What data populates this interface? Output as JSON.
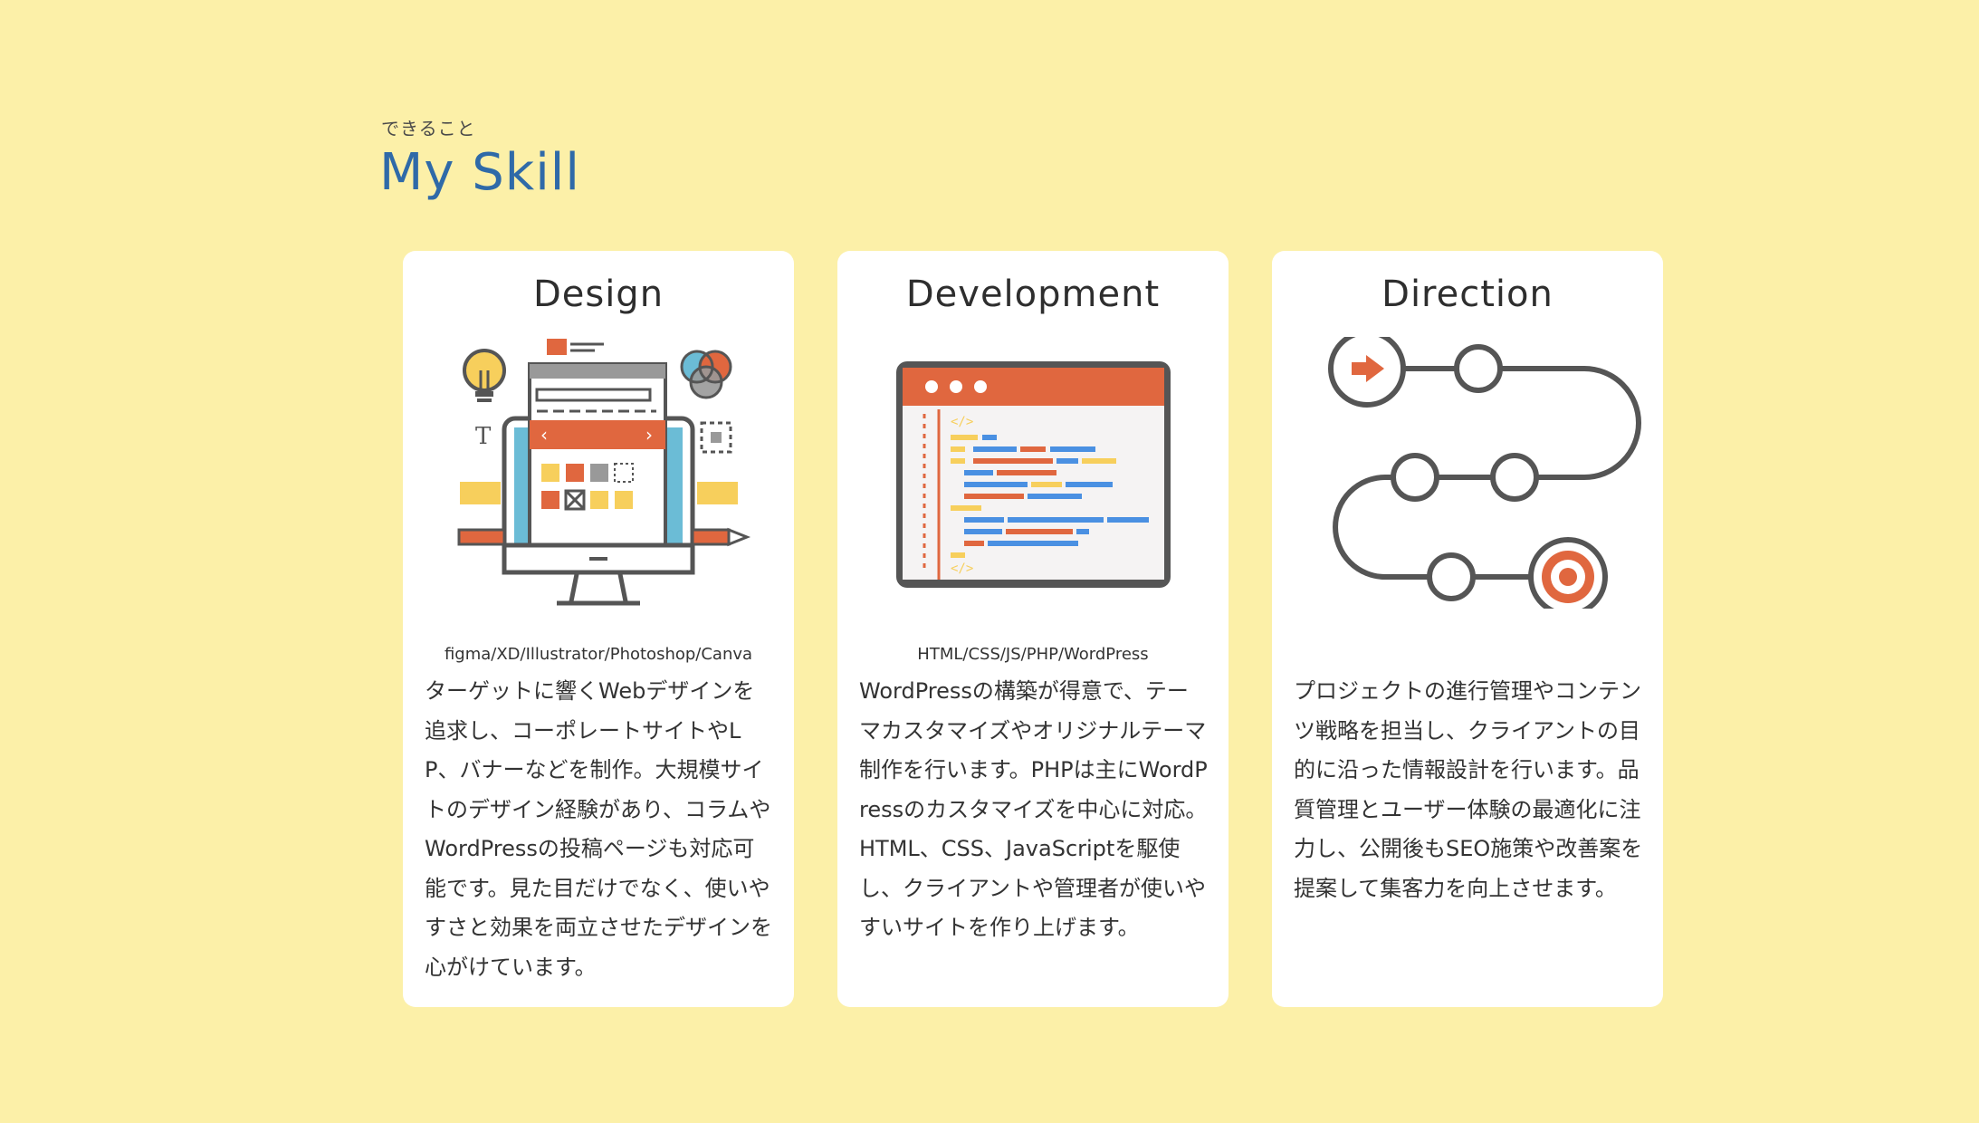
{
  "section": {
    "subtitle": "できること",
    "title": "My Skill"
  },
  "cards": [
    {
      "title": "Design",
      "icon": "web-design-illustration",
      "tools": "figma/XD/Illustrator/Photoshop/Canva",
      "description": "ターゲットに響くWebデザインを追求し、コーポレートサイトやLP、バナーなどを制作。大規模サイトのデザイン経験があり、コラムやWordPressの投稿ページも対応可能です。見た目だけでなく、使いやすさと効果を両立させたデザインを心がけています。"
    },
    {
      "title": "Development",
      "icon": "code-editor-illustration",
      "tools": "HTML/CSS/JS/PHP/WordPress",
      "description": "WordPressの構築が得意で、テーマカスタマイズやオリジナルテーマ制作を行います。PHPは主にWordPressのカスタマイズを中心に対応。HTML、CSS、JavaScriptを駆使し、クライアントや管理者が使いやすいサイトを作り上げます。"
    },
    {
      "title": "Direction",
      "icon": "roadmap-illustration",
      "tools": "",
      "description": "プロジェクトの進行管理やコンテンツ戦略を担当し、クライアントの目的に沿った情報設計を行います。品質管理とユーザー体験の最適化に注力し、公開後もSEO施策や改善案を提案して集客力を向上させます。"
    }
  ],
  "colors": {
    "background": "#fcf0a8",
    "title_blue": "#2f6aa8",
    "accent_orange": "#e0673f",
    "accent_blue": "#4a90e2",
    "accent_yellow": "#f7cf5c",
    "outline_gray": "#555555"
  }
}
